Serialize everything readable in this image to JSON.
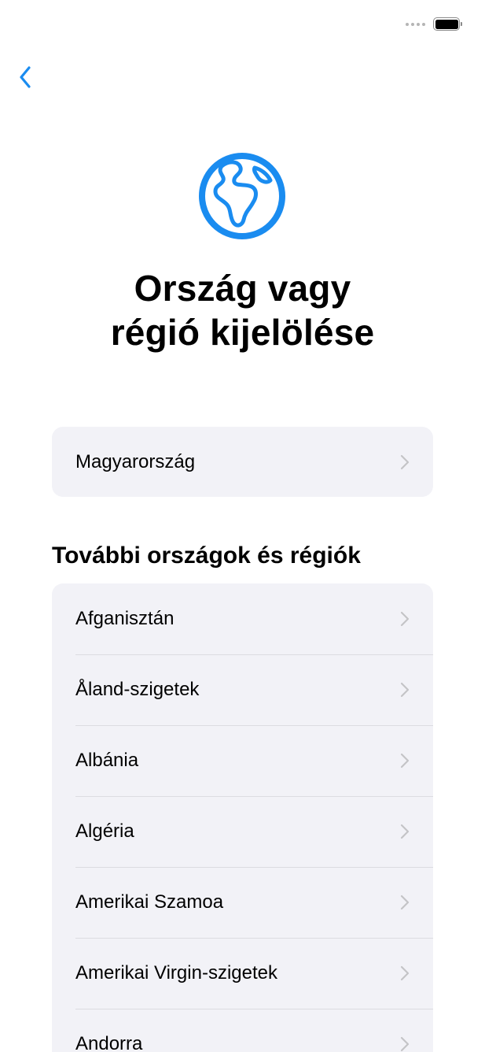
{
  "title": "Ország vagy\nrégió kijelölése",
  "title_line1": "Ország vagy",
  "title_line2": "régió kijelölése",
  "current_region": {
    "label": "Magyarország"
  },
  "section_header": "További országok és régiók",
  "regions": [
    {
      "label": "Afganisztán"
    },
    {
      "label": "Åland-szigetek"
    },
    {
      "label": "Albánia"
    },
    {
      "label": "Algéria"
    },
    {
      "label": "Amerikai Szamoa"
    },
    {
      "label": "Amerikai Virgin-szigetek"
    },
    {
      "label": "Andorra"
    }
  ],
  "icons": {
    "back": "chevron-left-icon",
    "hero": "globe-icon",
    "row": "chevron-right-icon"
  },
  "colors": {
    "accent": "#1a8cf0",
    "card_bg": "#f2f2f7",
    "chevron": "#c4c4c7"
  }
}
